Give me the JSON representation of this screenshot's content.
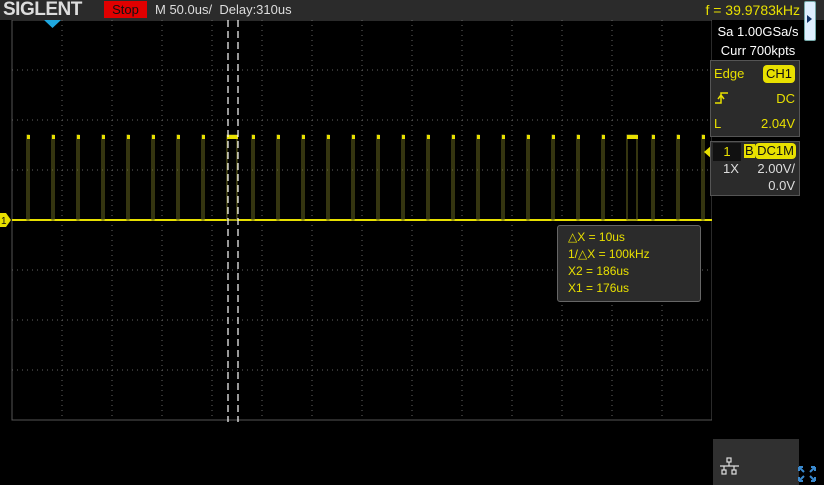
{
  "header": {
    "brand": "SIGLENT",
    "run_state": "Stop",
    "timebase": "M 50.0us/",
    "delay": "Delay:310us",
    "frequency": "f = 39.9783kHz"
  },
  "acquisition": {
    "sample_rate": "Sa 1.00GSa/s",
    "memory": "Curr 700kpts"
  },
  "trigger": {
    "type": "Edge",
    "source": "CH1",
    "slope_icon": "rising-edge-icon",
    "coupling": "DC",
    "level_label": "L",
    "level": "2.04V"
  },
  "channel": {
    "number": "1",
    "bw_limit": "B",
    "coupling": "DC1M",
    "probe": "1X",
    "scale": "2.00V/",
    "offset": "0.0V",
    "marker": "1"
  },
  "cursors": {
    "delta_x": "△X = 10us",
    "inv_delta_x": "1/△X = 100kHz",
    "x2": "X2 = 186us",
    "x1": "X1 = 176us"
  },
  "colors": {
    "trace": "#e8e000",
    "stop": "#e00000",
    "trigger_marker": "#1fa8e0"
  }
}
